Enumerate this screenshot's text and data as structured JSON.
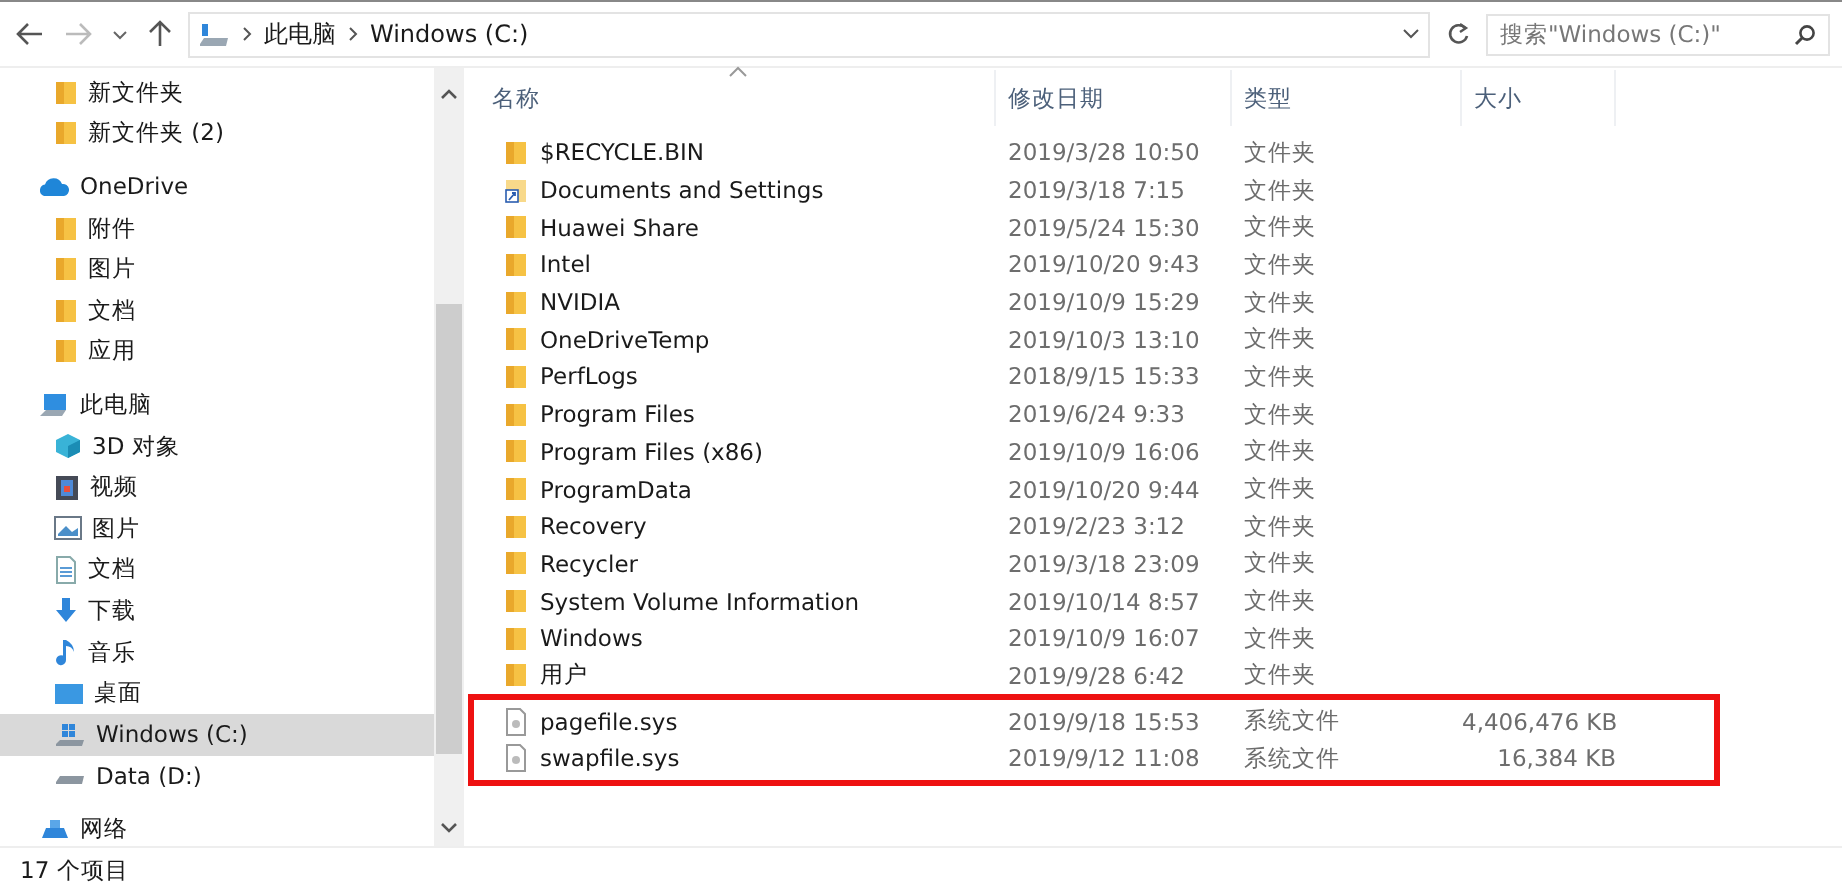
{
  "nav": {
    "path": [
      "此电脑",
      "Windows (C:)"
    ]
  },
  "search": {
    "placeholder": "搜索\"Windows (C:)\""
  },
  "sidebar": {
    "top_items": [
      {
        "kind": "folder",
        "label": "新文件夹"
      },
      {
        "kind": "folder",
        "label": "新文件夹 (2)"
      }
    ],
    "items": [
      {
        "kind": "cloud",
        "label": "OneDrive",
        "selected": false,
        "children": [
          {
            "kind": "folder",
            "label": "附件",
            "selected": false
          },
          {
            "kind": "folder",
            "label": "图片",
            "selected": false
          },
          {
            "kind": "folder",
            "label": "文档",
            "selected": false
          },
          {
            "kind": "folder",
            "label": "应用",
            "selected": false
          }
        ]
      },
      {
        "kind": "pc",
        "label": "此电脑",
        "selected": false,
        "children": [
          {
            "kind": "cube",
            "label": "3D 对象",
            "selected": false
          },
          {
            "kind": "video",
            "label": "视频",
            "selected": false
          },
          {
            "kind": "picture",
            "label": "图片",
            "selected": false
          },
          {
            "kind": "document",
            "label": "文档",
            "selected": false
          },
          {
            "kind": "download",
            "label": "下载",
            "selected": false
          },
          {
            "kind": "music",
            "label": "音乐",
            "selected": false
          },
          {
            "kind": "desktop",
            "label": "桌面",
            "selected": false
          },
          {
            "kind": "windrive",
            "label": "Windows (C:)",
            "selected": true
          },
          {
            "kind": "drive",
            "label": "Data (D:)",
            "selected": false
          }
        ]
      },
      {
        "kind": "network",
        "label": "网络",
        "selected": false
      }
    ]
  },
  "table": {
    "columns": [
      "名称",
      "修改日期",
      "类型",
      "大小"
    ],
    "rows": [
      {
        "kind": "folder",
        "name": "$RECYCLE.BIN",
        "date": "2019/3/28 10:50",
        "type": "文件夹",
        "highlighted": false
      },
      {
        "kind": "shortcut",
        "name": "Documents and Settings",
        "date": "2019/3/18 7:15",
        "type": "文件夹",
        "highlighted": false
      },
      {
        "kind": "folder",
        "name": "Huawei Share",
        "date": "2019/5/24 15:30",
        "type": "文件夹",
        "highlighted": false
      },
      {
        "kind": "folder",
        "name": "Intel",
        "date": "2019/10/20 9:43",
        "type": "文件夹",
        "highlighted": false
      },
      {
        "kind": "folder",
        "name": "NVIDIA",
        "date": "2019/10/9 15:29",
        "type": "文件夹",
        "highlighted": false
      },
      {
        "kind": "folder",
        "name": "OneDriveTemp",
        "date": "2019/10/3 13:10",
        "type": "文件夹",
        "highlighted": false
      },
      {
        "kind": "folder",
        "name": "PerfLogs",
        "date": "2018/9/15 15:33",
        "type": "文件夹",
        "highlighted": false
      },
      {
        "kind": "folder",
        "name": "Program Files",
        "date": "2019/6/24 9:33",
        "type": "文件夹",
        "highlighted": false
      },
      {
        "kind": "folder",
        "name": "Program Files (x86)",
        "date": "2019/10/9 16:06",
        "type": "文件夹",
        "highlighted": false
      },
      {
        "kind": "folder",
        "name": "ProgramData",
        "date": "2019/10/20 9:44",
        "type": "文件夹",
        "highlighted": false
      },
      {
        "kind": "folder",
        "name": "Recovery",
        "date": "2019/2/23 3:12",
        "type": "文件夹",
        "highlighted": false
      },
      {
        "kind": "folder",
        "name": "Recycler",
        "date": "2019/3/18 23:09",
        "type": "文件夹",
        "highlighted": false
      },
      {
        "kind": "folder",
        "name": "System Volume Information",
        "date": "2019/10/14 8:57",
        "type": "文件夹",
        "highlighted": false
      },
      {
        "kind": "folder",
        "name": "Windows",
        "date": "2019/10/9 16:07",
        "type": "文件夹",
        "highlighted": false
      },
      {
        "kind": "folder",
        "name": "用户",
        "date": "2019/9/28 6:42",
        "type": "文件夹",
        "highlighted": false
      },
      {
        "kind": "file",
        "name": "pagefile.sys",
        "date": "2019/9/18 15:53",
        "type": "系统文件",
        "size": "4,406,476 KB",
        "highlighted": true
      },
      {
        "kind": "file",
        "name": "swapfile.sys",
        "date": "2019/9/12 11:08",
        "type": "系统文件",
        "size": "16,384 KB",
        "highlighted": true
      }
    ]
  },
  "status_bar": {
    "item_count": "17 个项目"
  }
}
